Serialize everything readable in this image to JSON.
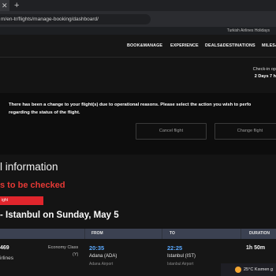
{
  "browser": {
    "tab_close": "✕",
    "new_tab": "+",
    "url": "m/en-tr/flights/manage-booking/dashboard/"
  },
  "topbar": {
    "holidays": "Turkish Airlines Holidays"
  },
  "nav": {
    "items": [
      "BOOK&MANAGE",
      "EXPERIENCE",
      "DEALS&DESTINATIONS",
      "MILES&"
    ]
  },
  "checkin": {
    "line1": "Check-in op",
    "line2": "2 Days 7 h"
  },
  "alert": {
    "line1": "There has been a change to your flight(s) due to operational reasons. Please select the action you wish to perfo",
    "line2": "regarding the status of the flight.",
    "cancel_label": "Cancel flight",
    "change_label": "Change flight"
  },
  "flight_info": {
    "title": "l information",
    "warning": "s to be checked",
    "action_label": "ight",
    "route": "- Istanbul on Sunday, May 5"
  },
  "table": {
    "headers": {
      "from": "FROM",
      "to": "TO",
      "duration": "DURATION"
    },
    "row": {
      "flight_no": "469",
      "airline": "irlines",
      "class": "Economy Class",
      "class_code": "(Y)",
      "dep_time": "20:35",
      "dep_airport": "Adana (ADA)",
      "dep_sub": "Adana Airport",
      "arr_time": "22:25",
      "arr_airport": "Istanbul (IST)",
      "arr_sub": "Istanbul Airport",
      "duration": "1h 50m"
    }
  },
  "taskbar": {
    "weather": "25°C  Kısmen g"
  },
  "colors": {
    "accent_time": "#5aa9ff",
    "alert_red": "#e53935",
    "header_bg": "#3b4151"
  }
}
